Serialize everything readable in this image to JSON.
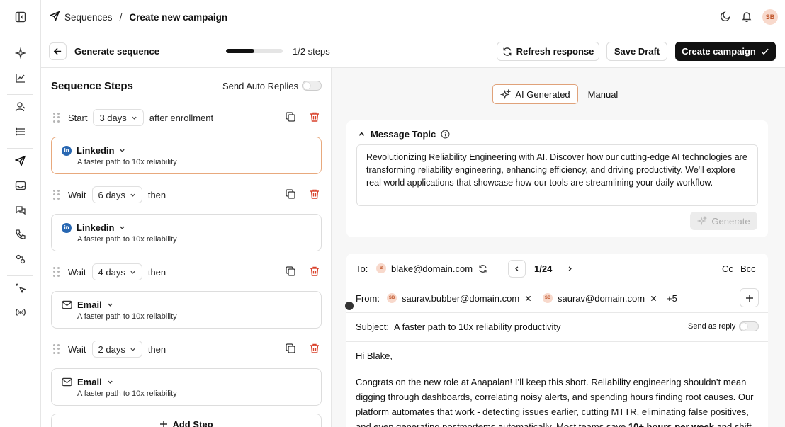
{
  "breadcrumb": {
    "section": "Sequences",
    "page": "Create new campaign"
  },
  "user": {
    "initials": "SB"
  },
  "header": {
    "title": "Generate sequence",
    "progress_fraction": 0.5,
    "steps_text": "1/2 steps",
    "refresh_label": "Refresh response",
    "save_draft_label": "Save Draft",
    "create_label": "Create campaign"
  },
  "left": {
    "title": "Sequence Steps",
    "auto_replies_label": "Send Auto Replies",
    "start": {
      "label": "Start",
      "delay": "3 days",
      "suffix": "after enrollment"
    },
    "waits": [
      {
        "label": "Wait",
        "delay": "6 days",
        "suffix": "then"
      },
      {
        "label": "Wait",
        "delay": "4 days",
        "suffix": "then"
      },
      {
        "label": "Wait",
        "delay": "2 days",
        "suffix": "then"
      }
    ],
    "cards": [
      {
        "channel": "Linkedin",
        "subject": "A faster path to 10x reliability",
        "icon": "linkedin-icon"
      },
      {
        "channel": "Linkedin",
        "subject": "A faster path to 10x reliability",
        "icon": "linkedin-icon"
      },
      {
        "channel": "Email",
        "subject": "A faster path to 10x reliability",
        "icon": "mail-icon"
      },
      {
        "channel": "Email",
        "subject": "A faster path to 10x reliability",
        "icon": "mail-icon"
      }
    ],
    "add_step_label": "Add Step"
  },
  "right": {
    "mode_ai": "AI Generated",
    "mode_manual": "Manual",
    "topic_label": "Message Topic",
    "topic_text": "Revolutionizing Reliability Engineering with AI. Discover how our cutting-edge AI technologies are transforming reliability engineering, enhancing efficiency, and driving productivity. We'll explore real world applications that showcase how our tools are streamlining your daily workflow.",
    "generate_label": "Generate",
    "to_label": "To:",
    "to_email": "blake@domain.com",
    "to_initial": "B",
    "pager": "1/24",
    "cc": "Cc",
    "bcc": "Bcc",
    "from_label": "From:",
    "from_1": "saurav.bubber@domain.com",
    "from_2": "saurav@domain.com",
    "from_more": "+5",
    "from_initials": "SB",
    "subject_label": "Subject:",
    "subject_text": "A faster path to 10x reliability productivity",
    "send_as_reply": "Send as reply",
    "greeting": "Hi Blake,",
    "body_lines": [
      "Congrats on the new role at Anapalan! I’ll keep this short. Reliability engineering shouldn’t mean",
      "digging through dashboards, correlating noisy alerts, and spending hours finding root causes. Our",
      "platform automates that work - detecting issues earlier, cutting MTTR, eliminating false positives,"
    ],
    "body_last_a": "and even generating postmortems automatically. Most teams save ",
    "body_last_b": "10+ hours per week",
    "body_last_c": " and shift"
  }
}
